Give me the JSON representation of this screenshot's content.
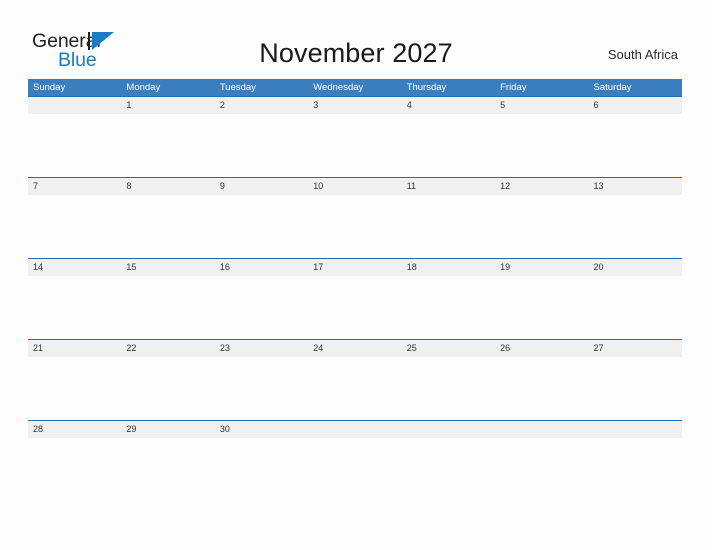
{
  "brand": {
    "name_part1": "General",
    "name_part2": "Blue",
    "color_dark": "#231f20",
    "color_blue": "#1b7cc4"
  },
  "header": {
    "title": "November 2027",
    "location": "South Africa"
  },
  "theme": {
    "header_blue": "#3b7ec0",
    "rule_blue": "#1f6eb0",
    "band_gray": "#f0f0f0",
    "page_background": "#fdfdfd"
  },
  "calendar": {
    "month": "November",
    "year": "2027",
    "weekday_headers": [
      "Sunday",
      "Monday",
      "Tuesday",
      "Wednesday",
      "Thursday",
      "Friday",
      "Saturday"
    ],
    "weeks": [
      [
        "",
        "1",
        "2",
        "3",
        "4",
        "5",
        "6"
      ],
      [
        "7",
        "8",
        "9",
        "10",
        "11",
        "12",
        "13"
      ],
      [
        "14",
        "15",
        "16",
        "17",
        "18",
        "19",
        "20"
      ],
      [
        "21",
        "22",
        "23",
        "24",
        "25",
        "26",
        "27"
      ],
      [
        "28",
        "29",
        "30",
        "",
        "",
        "",
        ""
      ]
    ]
  }
}
